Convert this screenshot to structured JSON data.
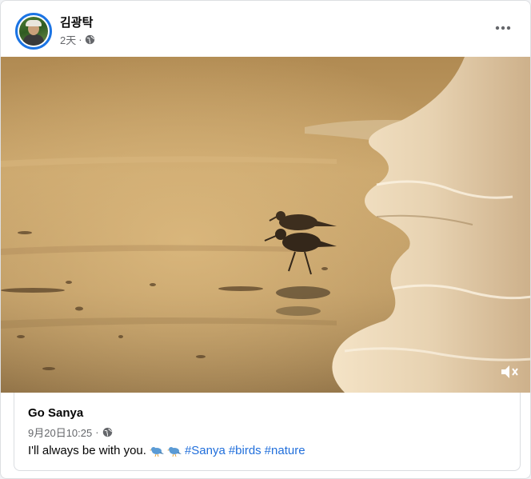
{
  "post": {
    "author": "김광탁",
    "time": "2天",
    "separator": "·",
    "more_icon": "more-horizontal-icon",
    "privacy_icon": "globe-icon"
  },
  "media": {
    "type": "video",
    "mute_icon": "speaker-muted-icon"
  },
  "caption": {
    "title": "Go Sanya",
    "date": "9月20日10:25",
    "separator": "·",
    "text": "I'll always be with you.",
    "emojis": [
      "bird-emoji",
      "bird-emoji"
    ],
    "hashtags": [
      "#Sanya",
      "#birds",
      "#nature"
    ]
  },
  "colors": {
    "accent": "#1b74e4",
    "link": "#216fdb",
    "secondary_text": "#65676b"
  }
}
